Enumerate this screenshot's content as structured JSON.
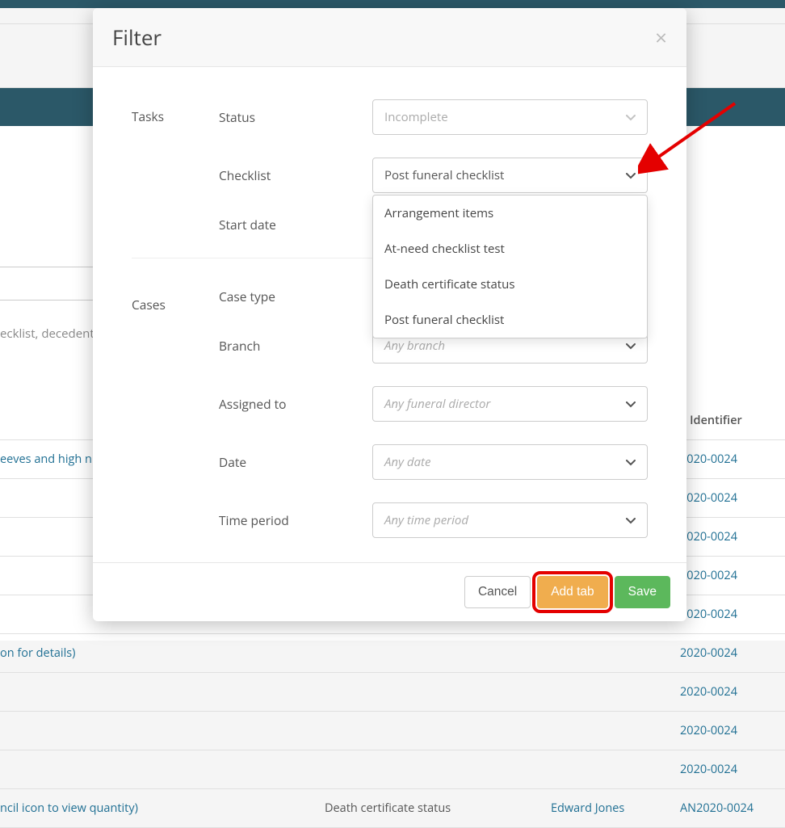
{
  "modal": {
    "title": "Filter",
    "sections": {
      "tasks": {
        "label": "Tasks",
        "status": {
          "label": "Status",
          "value": "Incomplete"
        },
        "checklist": {
          "label": "Checklist",
          "value": "Post funeral checklist",
          "options": [
            "Arrangement items",
            "At-need checklist test",
            "Death certificate status",
            "Post funeral checklist"
          ]
        },
        "start_date": {
          "label": "Start date"
        }
      },
      "cases": {
        "label": "Cases",
        "case_type": {
          "label": "Case type"
        },
        "branch": {
          "label": "Branch",
          "placeholder": "Any branch"
        },
        "assigned_to": {
          "label": "Assigned to",
          "placeholder": "Any funeral director"
        },
        "date": {
          "label": "Date",
          "placeholder": "Any date"
        },
        "time_period": {
          "label": "Time period",
          "placeholder": "Any time period"
        }
      }
    },
    "footer": {
      "cancel": "Cancel",
      "add_tab": "Add tab",
      "save": "Save"
    }
  },
  "background": {
    "search_hint": "ecklist, decedent",
    "table": {
      "header_id": "e Identifier",
      "rows": [
        {
          "left": "eeves and high n",
          "mid": "",
          "name": "",
          "id": "2020-0024"
        },
        {
          "left": "",
          "mid": "",
          "name": "",
          "id": "2020-0024"
        },
        {
          "left": "",
          "mid": "",
          "name": "",
          "id": "2020-0024"
        },
        {
          "left": "",
          "mid": "",
          "name": "",
          "id": "2020-0024"
        },
        {
          "left": "",
          "mid": "",
          "name": "",
          "id": "2020-0024"
        },
        {
          "left": "on for details)",
          "mid": "",
          "name": "",
          "id": "2020-0024"
        },
        {
          "left": "",
          "mid": "",
          "name": "",
          "id": "2020-0024"
        },
        {
          "left": "",
          "mid": "",
          "name": "",
          "id": "2020-0024"
        },
        {
          "left": "",
          "mid": "",
          "name": "",
          "id": "2020-0024"
        },
        {
          "left": "ncil icon to view quantity)",
          "mid": "Death certificate status",
          "name": "Edward Jones",
          "id": "AN2020-0024"
        }
      ]
    }
  }
}
